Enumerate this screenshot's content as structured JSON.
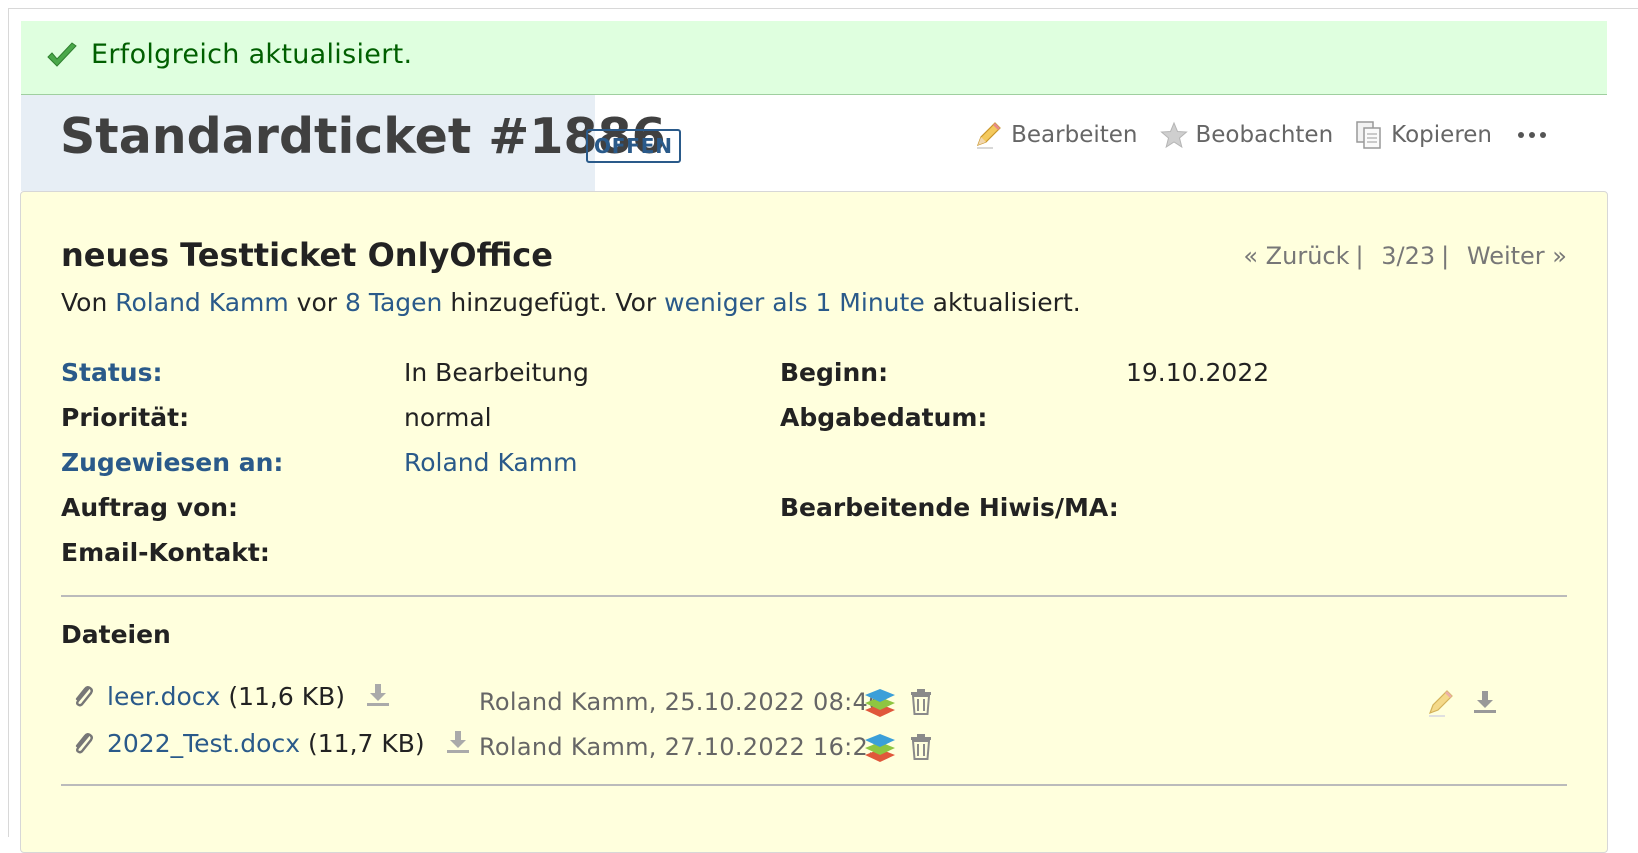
{
  "flash": {
    "message": "Erfolgreich aktualisiert."
  },
  "header": {
    "title": "Standardticket #1886",
    "status_badge": "OFFEN",
    "actions": {
      "edit": "Bearbeiten",
      "watch": "Beobachten",
      "copy": "Kopieren"
    }
  },
  "issue": {
    "subject": "neues Testticket OnlyOffice",
    "nav": {
      "prev": "« Zurück",
      "position": "3/23",
      "next": "Weiter »"
    },
    "author_line": {
      "prefix": "Von",
      "author": "Roland Kamm",
      "mid1": "vor",
      "created": "8 Tagen",
      "mid2": "hinzugefügt. Vor",
      "updated": "weniger als 1 Minute",
      "suffix": "aktualisiert."
    },
    "attributes": {
      "status_label": "Status:",
      "status_value": "In Bearbeitung",
      "priority_label": "Priorität:",
      "priority_value": "normal",
      "assignee_label": "Zugewiesen an:",
      "assignee_value": "Roland Kamm",
      "order_label": "Auftrag von:",
      "email_label": "Email-Kontakt:",
      "start_label": "Beginn:",
      "start_value": "19.10.2022",
      "due_label": "Abgabedatum:",
      "workers_label": "Bearbeitende Hiwis/MA:"
    },
    "files": {
      "heading": "Dateien",
      "items": [
        {
          "name": "leer.docx",
          "size": "(11,6 KB)",
          "meta": "Roland Kamm, 25.10.2022 08:46"
        },
        {
          "name": "2022_Test.docx",
          "size": "(11,7 KB)",
          "meta": "Roland Kamm, 27.10.2022 16:23"
        }
      ]
    }
  },
  "colors": {
    "link": "#2a5a8a",
    "flash_bg": "#dfffdf",
    "issue_bg": "#ffffdd",
    "title_bg": "#e7eef5"
  },
  "icons": [
    "checkmark-icon",
    "pencil-icon",
    "star-icon",
    "copy-icon",
    "more-icon",
    "paperclip-icon",
    "download-icon",
    "layers-icon",
    "trash-icon"
  ]
}
